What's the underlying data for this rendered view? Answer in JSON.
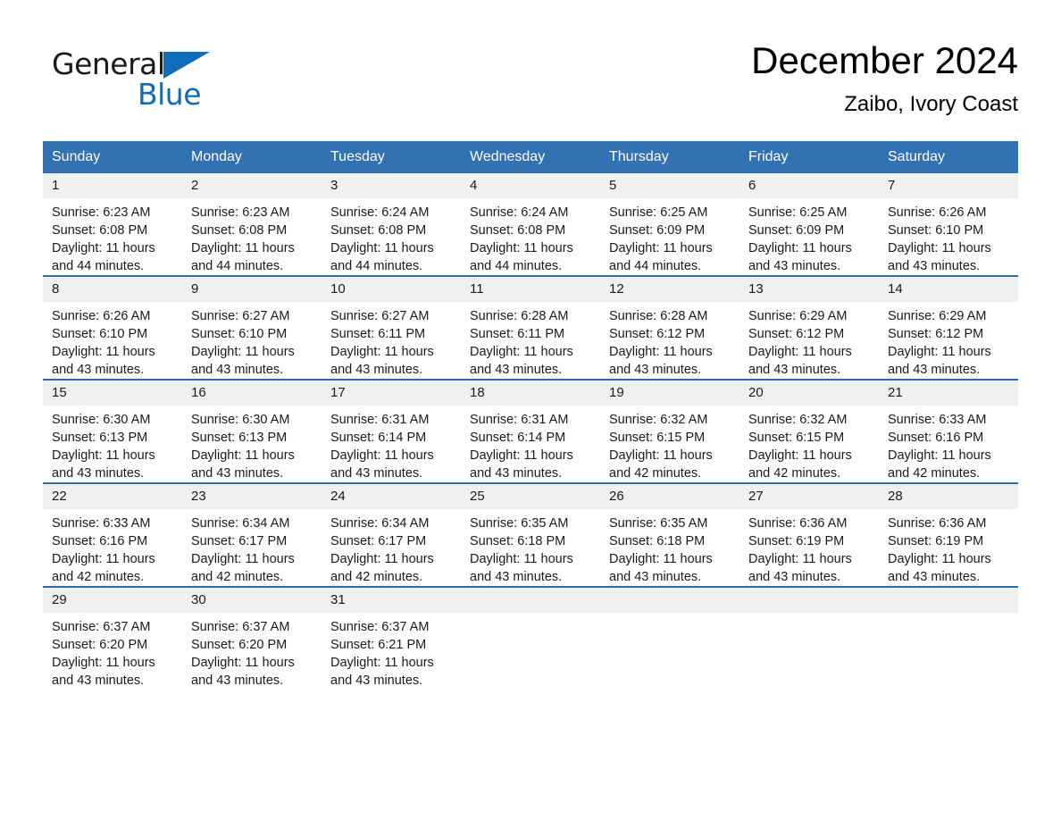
{
  "logo": {
    "word1": "General",
    "word2": "Blue",
    "triangle_color": "#0f6cb6",
    "word1_color": "#1a1a1a",
    "word2_color": "#0f6cb6"
  },
  "header": {
    "title": "December 2024",
    "subtitle": "Zaibo, Ivory Coast"
  },
  "theme": {
    "header_blue": "#3272B3",
    "row_rule_blue": "#2E6DA8",
    "daynum_band": "#F0F0F0",
    "page_background": "#FFFFFF",
    "text": "#1A1A1A"
  },
  "calendar": {
    "weekday_headers": [
      "Sunday",
      "Monday",
      "Tuesday",
      "Wednesday",
      "Thursday",
      "Friday",
      "Saturday"
    ],
    "weeks": [
      [
        {
          "day": "1",
          "sunrise": "Sunrise: 6:23 AM",
          "sunset": "Sunset: 6:08 PM",
          "daylight": "Daylight: 11 hours and 44 minutes."
        },
        {
          "day": "2",
          "sunrise": "Sunrise: 6:23 AM",
          "sunset": "Sunset: 6:08 PM",
          "daylight": "Daylight: 11 hours and 44 minutes."
        },
        {
          "day": "3",
          "sunrise": "Sunrise: 6:24 AM",
          "sunset": "Sunset: 6:08 PM",
          "daylight": "Daylight: 11 hours and 44 minutes."
        },
        {
          "day": "4",
          "sunrise": "Sunrise: 6:24 AM",
          "sunset": "Sunset: 6:08 PM",
          "daylight": "Daylight: 11 hours and 44 minutes."
        },
        {
          "day": "5",
          "sunrise": "Sunrise: 6:25 AM",
          "sunset": "Sunset: 6:09 PM",
          "daylight": "Daylight: 11 hours and 44 minutes."
        },
        {
          "day": "6",
          "sunrise": "Sunrise: 6:25 AM",
          "sunset": "Sunset: 6:09 PM",
          "daylight": "Daylight: 11 hours and 43 minutes."
        },
        {
          "day": "7",
          "sunrise": "Sunrise: 6:26 AM",
          "sunset": "Sunset: 6:10 PM",
          "daylight": "Daylight: 11 hours and 43 minutes."
        }
      ],
      [
        {
          "day": "8",
          "sunrise": "Sunrise: 6:26 AM",
          "sunset": "Sunset: 6:10 PM",
          "daylight": "Daylight: 11 hours and 43 minutes."
        },
        {
          "day": "9",
          "sunrise": "Sunrise: 6:27 AM",
          "sunset": "Sunset: 6:10 PM",
          "daylight": "Daylight: 11 hours and 43 minutes."
        },
        {
          "day": "10",
          "sunrise": "Sunrise: 6:27 AM",
          "sunset": "Sunset: 6:11 PM",
          "daylight": "Daylight: 11 hours and 43 minutes."
        },
        {
          "day": "11",
          "sunrise": "Sunrise: 6:28 AM",
          "sunset": "Sunset: 6:11 PM",
          "daylight": "Daylight: 11 hours and 43 minutes."
        },
        {
          "day": "12",
          "sunrise": "Sunrise: 6:28 AM",
          "sunset": "Sunset: 6:12 PM",
          "daylight": "Daylight: 11 hours and 43 minutes."
        },
        {
          "day": "13",
          "sunrise": "Sunrise: 6:29 AM",
          "sunset": "Sunset: 6:12 PM",
          "daylight": "Daylight: 11 hours and 43 minutes."
        },
        {
          "day": "14",
          "sunrise": "Sunrise: 6:29 AM",
          "sunset": "Sunset: 6:12 PM",
          "daylight": "Daylight: 11 hours and 43 minutes."
        }
      ],
      [
        {
          "day": "15",
          "sunrise": "Sunrise: 6:30 AM",
          "sunset": "Sunset: 6:13 PM",
          "daylight": "Daylight: 11 hours and 43 minutes."
        },
        {
          "day": "16",
          "sunrise": "Sunrise: 6:30 AM",
          "sunset": "Sunset: 6:13 PM",
          "daylight": "Daylight: 11 hours and 43 minutes."
        },
        {
          "day": "17",
          "sunrise": "Sunrise: 6:31 AM",
          "sunset": "Sunset: 6:14 PM",
          "daylight": "Daylight: 11 hours and 43 minutes."
        },
        {
          "day": "18",
          "sunrise": "Sunrise: 6:31 AM",
          "sunset": "Sunset: 6:14 PM",
          "daylight": "Daylight: 11 hours and 43 minutes."
        },
        {
          "day": "19",
          "sunrise": "Sunrise: 6:32 AM",
          "sunset": "Sunset: 6:15 PM",
          "daylight": "Daylight: 11 hours and 42 minutes."
        },
        {
          "day": "20",
          "sunrise": "Sunrise: 6:32 AM",
          "sunset": "Sunset: 6:15 PM",
          "daylight": "Daylight: 11 hours and 42 minutes."
        },
        {
          "day": "21",
          "sunrise": "Sunrise: 6:33 AM",
          "sunset": "Sunset: 6:16 PM",
          "daylight": "Daylight: 11 hours and 42 minutes."
        }
      ],
      [
        {
          "day": "22",
          "sunrise": "Sunrise: 6:33 AM",
          "sunset": "Sunset: 6:16 PM",
          "daylight": "Daylight: 11 hours and 42 minutes."
        },
        {
          "day": "23",
          "sunrise": "Sunrise: 6:34 AM",
          "sunset": "Sunset: 6:17 PM",
          "daylight": "Daylight: 11 hours and 42 minutes."
        },
        {
          "day": "24",
          "sunrise": "Sunrise: 6:34 AM",
          "sunset": "Sunset: 6:17 PM",
          "daylight": "Daylight: 11 hours and 42 minutes."
        },
        {
          "day": "25",
          "sunrise": "Sunrise: 6:35 AM",
          "sunset": "Sunset: 6:18 PM",
          "daylight": "Daylight: 11 hours and 43 minutes."
        },
        {
          "day": "26",
          "sunrise": "Sunrise: 6:35 AM",
          "sunset": "Sunset: 6:18 PM",
          "daylight": "Daylight: 11 hours and 43 minutes."
        },
        {
          "day": "27",
          "sunrise": "Sunrise: 6:36 AM",
          "sunset": "Sunset: 6:19 PM",
          "daylight": "Daylight: 11 hours and 43 minutes."
        },
        {
          "day": "28",
          "sunrise": "Sunrise: 6:36 AM",
          "sunset": "Sunset: 6:19 PM",
          "daylight": "Daylight: 11 hours and 43 minutes."
        }
      ],
      [
        {
          "day": "29",
          "sunrise": "Sunrise: 6:37 AM",
          "sunset": "Sunset: 6:20 PM",
          "daylight": "Daylight: 11 hours and 43 minutes."
        },
        {
          "day": "30",
          "sunrise": "Sunrise: 6:37 AM",
          "sunset": "Sunset: 6:20 PM",
          "daylight": "Daylight: 11 hours and 43 minutes."
        },
        {
          "day": "31",
          "sunrise": "Sunrise: 6:37 AM",
          "sunset": "Sunset: 6:21 PM",
          "daylight": "Daylight: 11 hours and 43 minutes."
        },
        {
          "day": "",
          "sunrise": "",
          "sunset": "",
          "daylight": ""
        },
        {
          "day": "",
          "sunrise": "",
          "sunset": "",
          "daylight": ""
        },
        {
          "day": "",
          "sunrise": "",
          "sunset": "",
          "daylight": ""
        },
        {
          "day": "",
          "sunrise": "",
          "sunset": "",
          "daylight": ""
        }
      ]
    ]
  }
}
